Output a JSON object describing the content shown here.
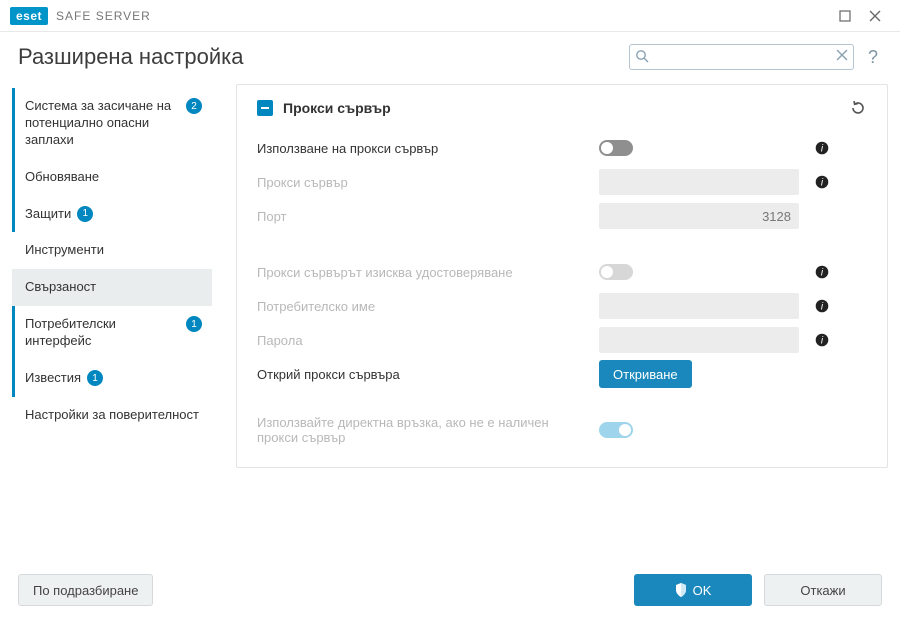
{
  "app": {
    "logo": "eset",
    "product": "SAFE SERVER"
  },
  "header": {
    "title": "Разширена настройка",
    "search_placeholder": ""
  },
  "sidebar": {
    "items": [
      {
        "label": "Система за засичане на потенциално опасни заплахи",
        "badge": "2",
        "marked": true
      },
      {
        "label": "Обновяване",
        "marked": true
      },
      {
        "label": "Защити",
        "badge": "1",
        "marked": true
      },
      {
        "label": "Инструменти"
      },
      {
        "label": "Свързаност",
        "active": true
      },
      {
        "label": "Потребителски интерфейс",
        "badge": "1",
        "marked": true
      },
      {
        "label": "Известия",
        "badge": "1",
        "marked": true
      },
      {
        "label": "Настройки за поверителност"
      }
    ]
  },
  "panel": {
    "section_title": "Прокси сървър",
    "rows": {
      "use_proxy": {
        "label": "Използване на прокси сървър",
        "on": false
      },
      "proxy_host": {
        "label": "Прокси сървър",
        "value": ""
      },
      "port": {
        "label": "Порт",
        "value": "3128"
      },
      "auth": {
        "label": "Прокси сървърът изисква удостоверяване",
        "on": false
      },
      "username": {
        "label": "Потребителско име",
        "value": ""
      },
      "password": {
        "label": "Парола",
        "value": ""
      },
      "detect": {
        "label": "Открий прокси сървъра",
        "button": "Откриване"
      },
      "direct": {
        "label": "Използвайте директна връзка, ако не е наличен прокси сървър",
        "on": true
      }
    }
  },
  "footer": {
    "defaults": "По подразбиране",
    "ok": "OK",
    "cancel": "Откажи"
  }
}
